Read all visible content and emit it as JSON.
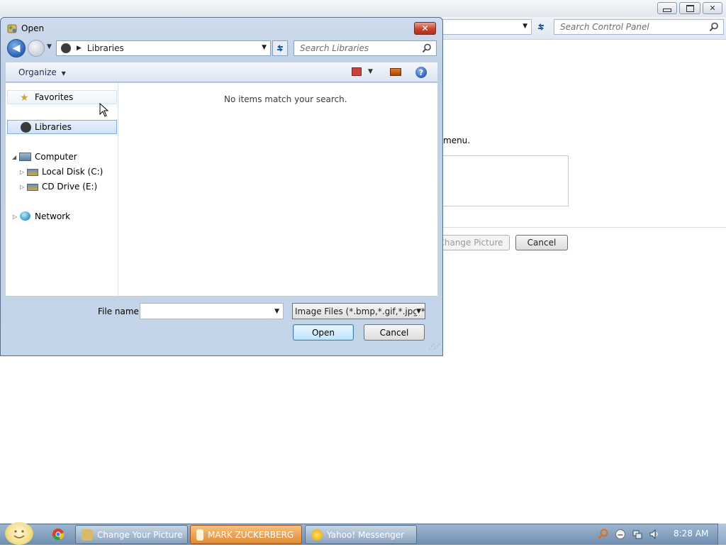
{
  "background_window": {
    "search_placeholder": "Search Control Panel",
    "instruction_tail": "menu.",
    "change_picture_label": "Change Picture",
    "cancel_label": "Cancel"
  },
  "dialog": {
    "title": "Open",
    "address": {
      "location": "Libraries"
    },
    "search_placeholder": "Search Libraries",
    "toolbar": {
      "organize_label": "Organize"
    },
    "nav_pane": {
      "favorites": "Favorites",
      "libraries": "Libraries",
      "computer": "Computer",
      "local_disk": "Local Disk (C:)",
      "cd_drive": "CD Drive (E:)",
      "network": "Network"
    },
    "empty_message": "No items match your search.",
    "file_name_label": "File name:",
    "file_name_value": "",
    "file_type": "Image Files (*.bmp,*.gif,*.jpg,*.",
    "open_label": "Open",
    "cancel_label": "Cancel"
  },
  "taskbar": {
    "items": [
      {
        "label": "Change Your Picture",
        "icon": "control-panel-icon",
        "active": false
      },
      {
        "label": "MARK ZUCKERBERG",
        "icon": "document-icon",
        "active": true
      },
      {
        "label": "Yahoo! Messenger",
        "icon": "yahoo-messenger-icon",
        "active": false
      }
    ],
    "clock": "8:28 AM"
  },
  "colors": {
    "dialog_frame": "#c5d5e9",
    "close_button": "#c7452f",
    "taskbar": "#7f9bbd",
    "active_task": "#e08a32"
  }
}
